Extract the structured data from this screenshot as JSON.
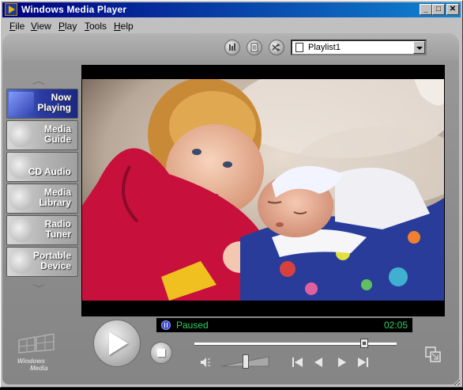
{
  "window": {
    "title": "Windows Media Player"
  },
  "title_buttons": {
    "minimize": "_",
    "maximize": "□",
    "close": "✕"
  },
  "menu": [
    {
      "first": "F",
      "rest": "ile"
    },
    {
      "first": "V",
      "rest": "iew"
    },
    {
      "first": "P",
      "rest": "lay"
    },
    {
      "first": "T",
      "rest": "ools"
    },
    {
      "first": "H",
      "rest": "elp"
    }
  ],
  "playlist": {
    "selected": "Playlist1"
  },
  "nav": [
    {
      "label": "Now\nPlaying",
      "active": true
    },
    {
      "label": "Media\nGuide",
      "active": false
    },
    {
      "label": "CD Audio",
      "active": false
    },
    {
      "label": "Media\nLibrary",
      "active": false
    },
    {
      "label": "Radio\nTuner",
      "active": false
    },
    {
      "label": "Portable\nDevice",
      "active": false
    }
  ],
  "status": {
    "state": "Paused",
    "time": "02:05"
  },
  "seek": {
    "position_fraction": 0.84
  },
  "volume": {
    "level_fraction": 0.5
  },
  "logo": {
    "line1": "Windows",
    "line2": "Media"
  },
  "icons": {
    "equalizer": "equalizer-icon",
    "playlist_info": "media-info-icon",
    "skin_chooser": "shuffle-icon"
  }
}
